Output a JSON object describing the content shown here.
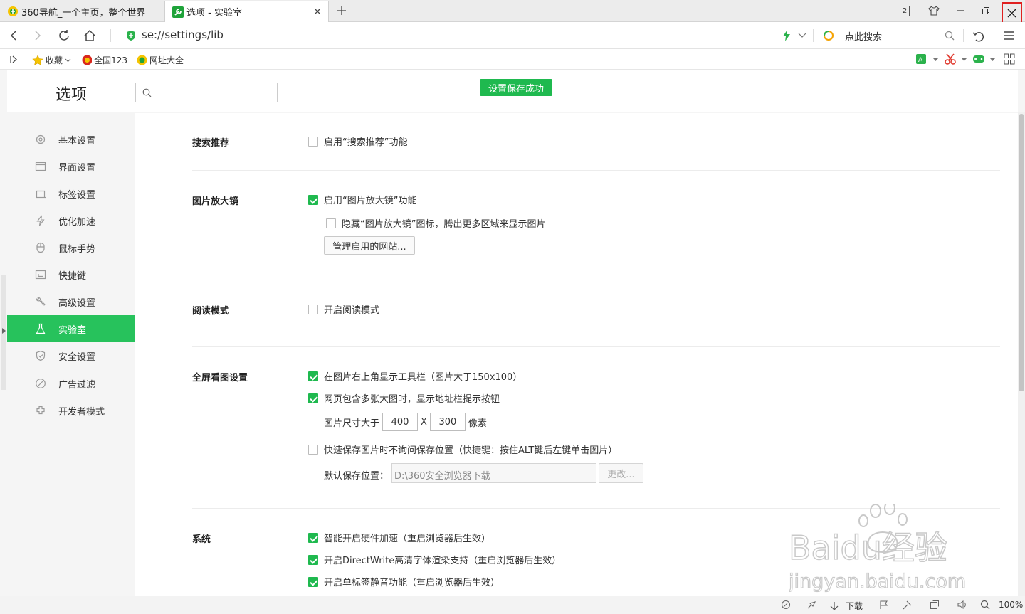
{
  "tabs": [
    {
      "title": "360导航_一个主页，整个世界",
      "active": false
    },
    {
      "title": "选项 - 实验室",
      "active": true
    }
  ],
  "window": {
    "badge_count": "2"
  },
  "address": {
    "url": "se://settings/lib",
    "search_placeholder": "点此搜索"
  },
  "bookmarks": {
    "favorites": "收藏",
    "items": [
      "全国123",
      "网址大全"
    ]
  },
  "page": {
    "title": "选项",
    "toast": "设置保存成功",
    "search_placeholder": ""
  },
  "sidebar": {
    "items": [
      {
        "label": "基本设置",
        "icon": "gear-icon"
      },
      {
        "label": "界面设置",
        "icon": "window-icon"
      },
      {
        "label": "标签设置",
        "icon": "tab-icon"
      },
      {
        "label": "优化加速",
        "icon": "lightning-icon"
      },
      {
        "label": "鼠标手势",
        "icon": "mouse-icon"
      },
      {
        "label": "快捷键",
        "icon": "keyboard-icon"
      },
      {
        "label": "高级设置",
        "icon": "wrench-icon"
      },
      {
        "label": "实验室",
        "icon": "flask-icon",
        "active": true
      },
      {
        "label": "安全设置",
        "icon": "shield-icon"
      },
      {
        "label": "广告过滤",
        "icon": "block-icon"
      },
      {
        "label": "开发者模式",
        "icon": "puzzle-icon"
      }
    ]
  },
  "sections": {
    "search_suggest": {
      "title": "搜索推荐",
      "option": {
        "label": "启用“搜索推荐”功能",
        "checked": false
      }
    },
    "magnifier": {
      "title": "图片放大镜",
      "enable": {
        "label": "启用“图片放大镜”功能",
        "checked": true
      },
      "hide_icon": {
        "label": "隐藏“图片放大镜”图标，腾出更多区域来显示图片",
        "checked": false
      },
      "manage_button": "管理启用的网站..."
    },
    "reading": {
      "title": "阅读模式",
      "option": {
        "label": "开启阅读模式",
        "checked": false
      }
    },
    "fullscreen": {
      "title": "全屏看图设置",
      "toolbar": {
        "label": "在图片右上角显示工具栏（图片大于150x100）",
        "checked": true
      },
      "address_hint": {
        "label": "网页包含多张大图时，显示地址栏提示按钮",
        "checked": true
      },
      "size_label": "图片尺寸大于",
      "width": "400",
      "times": "X",
      "height": "300",
      "unit": "像素",
      "quick_save": {
        "label": "快速保存图片时不询问保存位置（快捷键：按住ALT键后左键单击图片）",
        "checked": false
      },
      "default_path_label": "默认保存位置：",
      "default_path": "D:\\360安全浏览器下载",
      "change_button": "更改..."
    },
    "system": {
      "title": "系统",
      "hw_accel": {
        "label": "智能开启硬件加速（重启浏览器后生效）",
        "checked": true
      },
      "directwrite": {
        "label": "开启DirectWrite高清字体渲染支持（重启浏览器后生效）",
        "checked": true
      },
      "mute": {
        "label": "开启单标签静音功能（重启浏览器后生效）",
        "checked": true
      }
    }
  },
  "statusbar": {
    "download": "下载",
    "zoom": "100%"
  },
  "watermark": {
    "brand": "Baidu经验",
    "url": "jingyan.baidu.com"
  },
  "colors": {
    "accent": "#27c25c",
    "check": "#1fb94f",
    "highlight_box": "#e02020"
  }
}
